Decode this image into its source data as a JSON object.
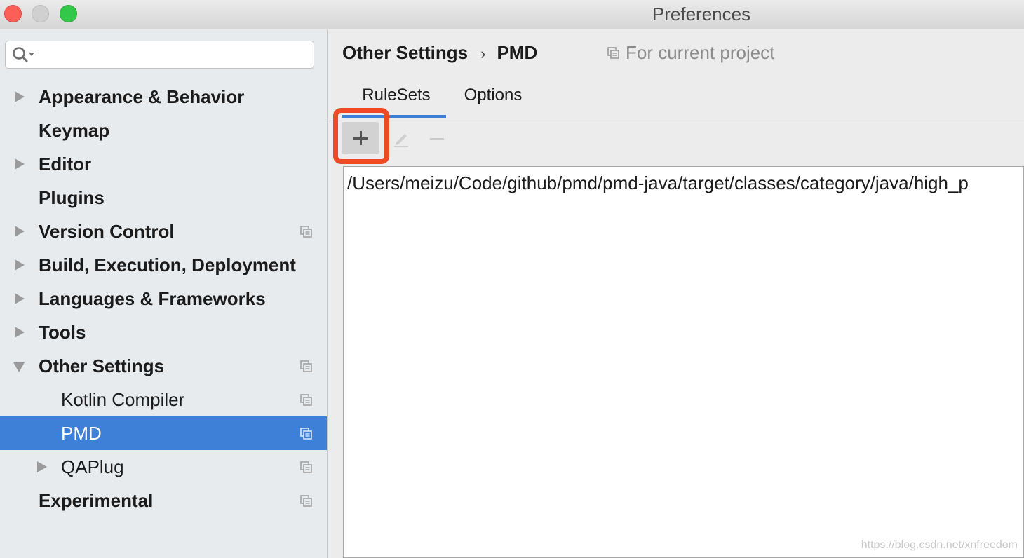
{
  "window": {
    "title": "Preferences"
  },
  "search": {
    "placeholder": "",
    "value": ""
  },
  "sidebar": {
    "items": [
      {
        "label": "Appearance & Behavior",
        "level": 0,
        "expander": "collapsed",
        "project_icon": false,
        "selected": false
      },
      {
        "label": "Keymap",
        "level": 0,
        "expander": "none",
        "project_icon": false,
        "selected": false
      },
      {
        "label": "Editor",
        "level": 0,
        "expander": "collapsed",
        "project_icon": false,
        "selected": false
      },
      {
        "label": "Plugins",
        "level": 0,
        "expander": "none",
        "project_icon": false,
        "selected": false
      },
      {
        "label": "Version Control",
        "level": 0,
        "expander": "collapsed",
        "project_icon": true,
        "selected": false
      },
      {
        "label": "Build, Execution, Deployment",
        "level": 0,
        "expander": "collapsed",
        "project_icon": false,
        "selected": false
      },
      {
        "label": "Languages & Frameworks",
        "level": 0,
        "expander": "collapsed",
        "project_icon": false,
        "selected": false
      },
      {
        "label": "Tools",
        "level": 0,
        "expander": "collapsed",
        "project_icon": false,
        "selected": false
      },
      {
        "label": "Other Settings",
        "level": 0,
        "expander": "expanded",
        "project_icon": true,
        "selected": false
      },
      {
        "label": "Kotlin Compiler",
        "level": 1,
        "expander": "none",
        "project_icon": true,
        "selected": false
      },
      {
        "label": "PMD",
        "level": 1,
        "expander": "none",
        "project_icon": true,
        "selected": true
      },
      {
        "label": "QAPlug",
        "level": 1,
        "expander": "collapsed",
        "project_icon": true,
        "selected": false
      },
      {
        "label": "Experimental",
        "level": 0,
        "expander": "none",
        "project_icon": true,
        "selected": false
      }
    ]
  },
  "header": {
    "breadcrumb_parent": "Other Settings",
    "breadcrumb_separator": "›",
    "breadcrumb_current": "PMD",
    "scope_label": "For current project"
  },
  "tabs": [
    {
      "label": "RuleSets",
      "active": true
    },
    {
      "label": "Options",
      "active": false
    }
  ],
  "toolbar": {
    "add_icon": "plus-icon",
    "edit_icon": "pencil-icon",
    "remove_icon": "minus-icon",
    "add_highlighted": true
  },
  "rulesets": {
    "rows": [
      "/Users/meizu/Code/github/pmd/pmd-java/target/classes/category/java/high_p"
    ]
  },
  "watermark": "https://blog.csdn.net/xnfreedom",
  "colors": {
    "selection": "#3e7fd8",
    "sidebar_bg": "#e7ebee",
    "highlight_box": "#f04a24",
    "tab_underline": "#3e7fd8"
  }
}
